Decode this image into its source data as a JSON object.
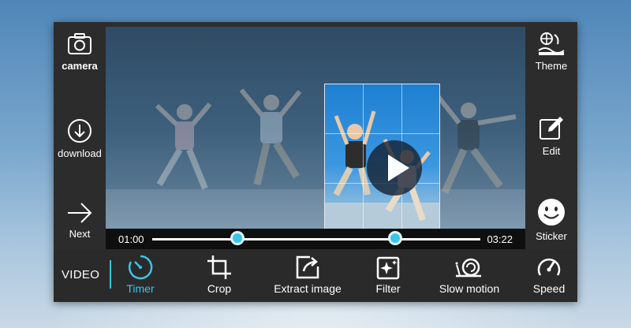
{
  "sidebar_left": [
    {
      "label": "camera",
      "icon": "camera-icon"
    },
    {
      "label": "download",
      "icon": "download-icon"
    },
    {
      "label": "Next",
      "icon": "arrow-right-icon"
    }
  ],
  "sidebar_right": [
    {
      "label": "Theme",
      "icon": "theme-icon"
    },
    {
      "label": "Edit",
      "icon": "edit-icon"
    },
    {
      "label": "Sticker",
      "icon": "smiley-icon"
    }
  ],
  "player": {
    "current_time": "01:00",
    "total_time": "03:22",
    "trim_start_fraction": 0.26,
    "trim_end_fraction": 0.74
  },
  "toolbar": {
    "mode": "VIDEO",
    "tools": [
      {
        "label": "Timer",
        "icon": "timer-icon",
        "active": true
      },
      {
        "label": "Crop",
        "icon": "crop-icon",
        "active": false
      },
      {
        "label": "Extract image",
        "icon": "extract-image-icon",
        "active": false
      },
      {
        "label": "Filter",
        "icon": "filter-icon",
        "active": false
      },
      {
        "label": "Slow motion",
        "icon": "snail-icon",
        "active": false
      },
      {
        "label": "Speed",
        "icon": "speedometer-icon",
        "active": false
      }
    ]
  },
  "colors": {
    "accent": "#39c6e8",
    "panel": "#2c2c2c",
    "text": "#ffffff"
  }
}
